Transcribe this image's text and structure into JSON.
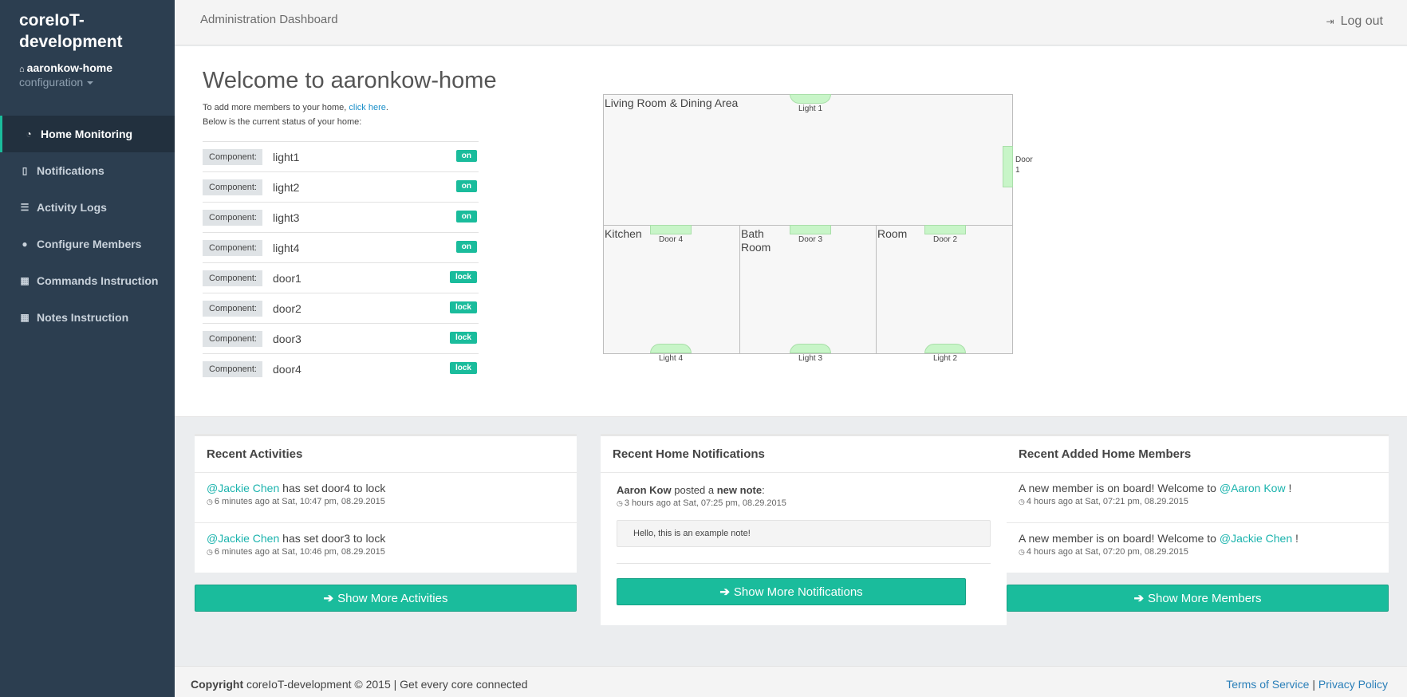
{
  "sidebar": {
    "brand": "coreIoT-development",
    "home_name": "aaronkow-home",
    "config_label": "configuration",
    "items": [
      {
        "label": "Home Monitoring",
        "icon": "dashboard-icon"
      },
      {
        "label": "Notifications",
        "icon": "file-icon"
      },
      {
        "label": "Activity Logs",
        "icon": "list-icon"
      },
      {
        "label": "Configure Members",
        "icon": "user-icon"
      },
      {
        "label": "Commands Instruction",
        "icon": "grid-icon"
      },
      {
        "label": "Notes Instruction",
        "icon": "grid-icon"
      }
    ]
  },
  "header": {
    "title": "Administration Dashboard",
    "logout_label": "Log out"
  },
  "main": {
    "welcome": "Welcome to aaronkow-home",
    "intro_prefix": "To add more members to your home, ",
    "intro_link": "click here",
    "intro_suffix": ".",
    "intro_line2": "Below is the current status of your home:",
    "component_label": "Component:",
    "components": [
      {
        "name": "light1",
        "status": "on"
      },
      {
        "name": "light2",
        "status": "on"
      },
      {
        "name": "light3",
        "status": "on"
      },
      {
        "name": "light4",
        "status": "on"
      },
      {
        "name": "door1",
        "status": "lock"
      },
      {
        "name": "door2",
        "status": "lock"
      },
      {
        "name": "door3",
        "status": "lock"
      },
      {
        "name": "door4",
        "status": "lock"
      }
    ]
  },
  "floorplan": {
    "rooms": {
      "living": "Living Room & Dining Area",
      "kitchen": "Kitchen",
      "bath": "Bath Room",
      "room": "Room"
    },
    "fixtures": {
      "light1": "Light 1",
      "light2": "Light 2",
      "light3": "Light 3",
      "light4": "Light 4",
      "door1": "Door 1",
      "door2": "Door 2",
      "door3": "Door 3",
      "door4": "Door 4"
    }
  },
  "activities": {
    "title": "Recent Activities",
    "items": [
      {
        "user": "@Jackie Chen",
        "text": " has set door4 to lock",
        "time": "6 minutes ago at Sat, 10:47 pm, 08.29.2015"
      },
      {
        "user": "@Jackie Chen",
        "text": " has set door3 to lock",
        "time": "6 minutes ago at Sat, 10:46 pm, 08.29.2015"
      }
    ],
    "button": "Show More Activities"
  },
  "notifications": {
    "title": "Recent Home Notifications",
    "author": "Aaron Kow",
    "mid": " posted a ",
    "kind": "new note",
    "colon": ":",
    "time": "3 hours ago at Sat, 07:25 pm, 08.29.2015",
    "note": "Hello, this is an example note!",
    "button": "Show More Notifications"
  },
  "members": {
    "title": "Recent Added Home Members",
    "prefix": "A new member is on board! Welcome to ",
    "suffix": " !",
    "items": [
      {
        "user": "@Aaron Kow",
        "time": "4 hours ago at Sat, 07:21 pm, 08.29.2015"
      },
      {
        "user": "@Jackie Chen",
        "time": "4 hours ago at Sat, 07:20 pm, 08.29.2015"
      }
    ],
    "button": "Show More Members"
  },
  "footer": {
    "copyright_bold": "Copyright",
    "copyright_text": " coreIoT-development © 2015 | Get every core connected",
    "terms": "Terms of Service",
    "separator": " | ",
    "privacy": "Privacy Policy"
  },
  "colors": {
    "accent": "#1abc9c",
    "sidebar": "#2c3e50",
    "fixture": "#c8f5c8",
    "link": "#1ab3ad"
  }
}
